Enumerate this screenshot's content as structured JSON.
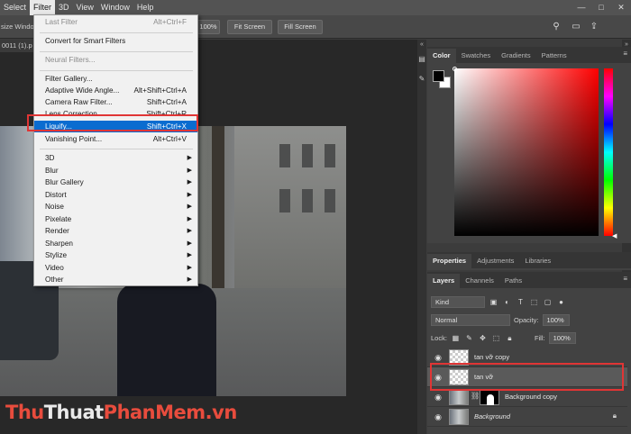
{
  "menubar": {
    "items": [
      "Select",
      "Filter",
      "3D",
      "View",
      "Window",
      "Help"
    ],
    "window_controls": [
      "—",
      "□",
      "✕"
    ]
  },
  "optbar": {
    "left_text": "size Window",
    "zoom_button": "100%",
    "fit_screen": "Fit Screen",
    "fill_screen": "Fill Screen"
  },
  "document": {
    "tab_label": "0011 (1).p"
  },
  "watermark": {
    "part1": "Thu",
    "part2": "Thuat",
    "part3": "PhanMem.vn"
  },
  "filter_menu": {
    "last_filter": {
      "label": "Last Filter",
      "shortcut": "Alt+Ctrl+F"
    },
    "convert": {
      "label": "Convert for Smart Filters"
    },
    "neural": {
      "label": "Neural Filters..."
    },
    "gallery": {
      "label": "Filter Gallery..."
    },
    "adaptive": {
      "label": "Adaptive Wide Angle...",
      "shortcut": "Alt+Shift+Ctrl+A"
    },
    "camera_raw": {
      "label": "Camera Raw Filter...",
      "shortcut": "Shift+Ctrl+A"
    },
    "lens": {
      "label": "Lens Correction...",
      "shortcut": "Shift+Ctrl+R"
    },
    "liquify": {
      "label": "Liquify...",
      "shortcut": "Shift+Ctrl+X"
    },
    "vanishing": {
      "label": "Vanishing Point...",
      "shortcut": "Alt+Ctrl+V"
    },
    "submenus": [
      "3D",
      "Blur",
      "Blur Gallery",
      "Distort",
      "Noise",
      "Pixelate",
      "Render",
      "Sharpen",
      "Stylize",
      "Video",
      "Other"
    ]
  },
  "color_panel": {
    "tabs": [
      "Color",
      "Swatches",
      "Gradients",
      "Patterns"
    ]
  },
  "properties_panel": {
    "tabs": [
      "Properties",
      "Adjustments",
      "Libraries"
    ]
  },
  "layers_panel": {
    "tabs": [
      "Layers",
      "Channels",
      "Paths"
    ],
    "kind_filter": "Kind",
    "blend_mode": "Normal",
    "opacity_label": "Opacity:",
    "opacity_value": "100%",
    "lock_label": "Lock:",
    "fill_label": "Fill:",
    "fill_value": "100%",
    "layers": [
      {
        "name": "tan vỡ copy"
      },
      {
        "name": "tan vỡ"
      },
      {
        "name": "Background copy"
      },
      {
        "name": "Background"
      }
    ]
  },
  "colors": {
    "highlight": "#0a6cd0",
    "annotation": "#e03535"
  }
}
